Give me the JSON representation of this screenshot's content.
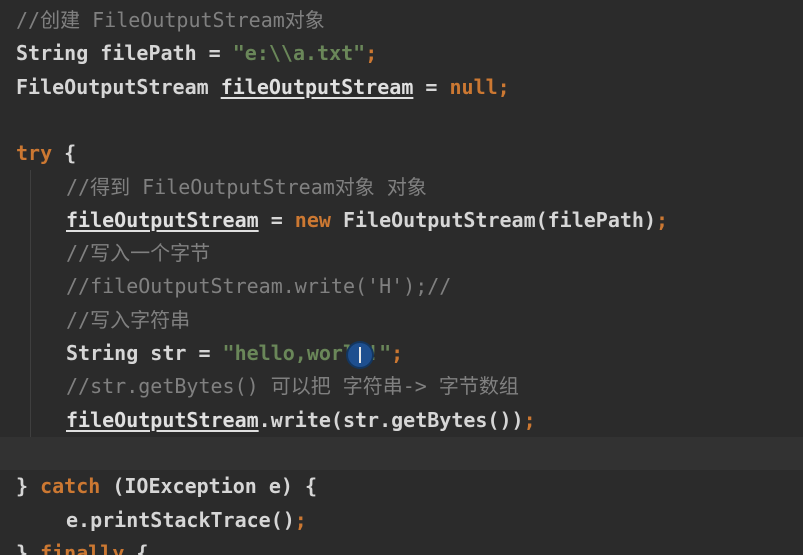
{
  "editor": {
    "language": "Java",
    "lines": [
      {
        "indent": 0,
        "current": false,
        "tokens": [
          {
            "t": "cmt",
            "v": "//创建 FileOutputStream对象"
          }
        ]
      },
      {
        "indent": 0,
        "current": false,
        "tokens": [
          {
            "t": "plain",
            "v": "String filePath = "
          },
          {
            "t": "str",
            "v": "\"e:\\\\a.txt\""
          },
          {
            "t": "punct",
            "v": ";"
          }
        ]
      },
      {
        "indent": 0,
        "current": false,
        "tokens": [
          {
            "t": "plain",
            "v": "FileOutputStream "
          },
          {
            "t": "field",
            "v": "fileOutputStream"
          },
          {
            "t": "plain",
            "v": " = "
          },
          {
            "t": "kw",
            "v": "null"
          },
          {
            "t": "punct",
            "v": ";"
          }
        ]
      },
      {
        "indent": 0,
        "current": false,
        "tokens": []
      },
      {
        "indent": 0,
        "current": false,
        "tokens": [
          {
            "t": "kw",
            "v": "try"
          },
          {
            "t": "plain",
            "v": " {"
          }
        ]
      },
      {
        "indent": 1,
        "current": false,
        "tokens": [
          {
            "t": "cmt",
            "v": "//得到 FileOutputStream对象 对象"
          }
        ]
      },
      {
        "indent": 1,
        "current": false,
        "tokens": [
          {
            "t": "field",
            "v": "fileOutputStream"
          },
          {
            "t": "plain",
            "v": " = "
          },
          {
            "t": "kw",
            "v": "new"
          },
          {
            "t": "plain",
            "v": " FileOutputStream(filePath)"
          },
          {
            "t": "punct",
            "v": ";"
          }
        ]
      },
      {
        "indent": 1,
        "current": false,
        "tokens": [
          {
            "t": "cmt",
            "v": "//写入一个字节"
          }
        ]
      },
      {
        "indent": 1,
        "current": false,
        "tokens": [
          {
            "t": "cmt",
            "v": "//fileOutputStream.write('H');//"
          }
        ]
      },
      {
        "indent": 1,
        "current": false,
        "tokens": [
          {
            "t": "cmt",
            "v": "//写入字符串"
          }
        ]
      },
      {
        "indent": 1,
        "current": false,
        "tokens": [
          {
            "t": "plain",
            "v": "String str = "
          },
          {
            "t": "str",
            "v": "\"hello,world!\""
          },
          {
            "t": "punct",
            "v": ";"
          }
        ]
      },
      {
        "indent": 1,
        "current": false,
        "tokens": [
          {
            "t": "cmt",
            "v": "//str.getBytes() 可以把 字符串-> 字节数组"
          }
        ]
      },
      {
        "indent": 1,
        "current": false,
        "tokens": [
          {
            "t": "field",
            "v": "fileOutputStream"
          },
          {
            "t": "plain",
            "v": ".write(str.getBytes())"
          },
          {
            "t": "punct",
            "v": ";"
          }
        ]
      },
      {
        "indent": 0,
        "current": true,
        "tokens": []
      },
      {
        "indent": 0,
        "current": false,
        "tokens": [
          {
            "t": "plain",
            "v": "} "
          },
          {
            "t": "kw",
            "v": "catch"
          },
          {
            "t": "plain",
            "v": " (IOException e) {"
          }
        ]
      },
      {
        "indent": 1,
        "current": false,
        "tokens": [
          {
            "t": "plain",
            "v": "e.printStackTrace()"
          },
          {
            "t": "punct",
            "v": ";"
          }
        ]
      },
      {
        "indent": 0,
        "current": false,
        "tokens": [
          {
            "t": "plain",
            "v": "} "
          },
          {
            "t": "kw",
            "v": "finally"
          },
          {
            "t": "plain",
            "v": " {"
          }
        ]
      }
    ]
  },
  "colors": {
    "background": "#2b2b2b",
    "current_line": "#323232",
    "keyword": "#cc7832",
    "string": "#6a8759",
    "comment": "#808080",
    "text": "#d6d6d6"
  },
  "cursor": {
    "icon": "text-cursor-icon"
  }
}
